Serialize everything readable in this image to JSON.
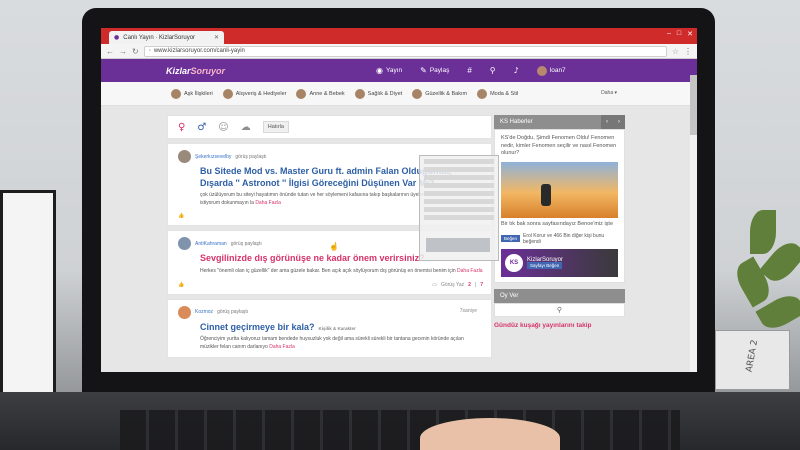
{
  "browser": {
    "tab_title": "Canlı Yayın · KizlarSoruyor",
    "url": "www.kizlarsoruyor.com/canli-yayin"
  },
  "site": {
    "logo_prefix": "Kizlar",
    "logo_suffix": "Soruyor",
    "nav": {
      "live": "Yayın",
      "share": "Paylaş",
      "hash": "#",
      "user": "loan7"
    }
  },
  "categories": [
    {
      "label": "Aşk İlişkileri"
    },
    {
      "label": "Alışveriş & Hediyeler"
    },
    {
      "label": "Anne & Bebek"
    },
    {
      "label": "Sağlık & Diyet"
    },
    {
      "label": "Güzellik & Bakım"
    },
    {
      "label": "Moda & Stil"
    }
  ],
  "categories_more": "Daha",
  "filter": {
    "chip": "Hatırla"
  },
  "posts": [
    {
      "author": "Şekerkızsevelby",
      "action": "görüş paylaştı",
      "title": "Bu Sitede Mod vs. Master Guru ft. admin Falan Olduğunda, Dışarda '' Astronot '' İlgisi Göreceğini Düşünen Var Mı?",
      "body": "çok üzülüyorum bu siteyi hayatımın önünde tutan ve her söylemeni kafasına takıp başkalarının üyelere lütfen örneklemek istiyorum dokunmayın la",
      "more": "Daha Fazla"
    },
    {
      "author": "AntiKahraman",
      "action": "görüş paylaştı",
      "title": "Sevgilinizde dış görünüşe ne kadar önem verirsiniz?",
      "body": "Herkes \"önemli olan iç güzellik\" der ama güzele bakar. Ben açık açık söylüyorum dış görünüş en önemisi benim için",
      "more": "Daha Fazla",
      "footer_label": "Görüş Yaz",
      "footer_a": "2",
      "footer_b": "7"
    },
    {
      "author": "Kozmoz",
      "action": "görüş paylaştı",
      "time": "7saniye",
      "title": "Cinnet geçirmeye bir kala?",
      "tag": "Kişilik & Karakter",
      "body": "Öğrenciyim yurtta kalıyoruz tamam bendede huysuzluk yok değil ama sürekli sürekli bir tantana gecenin köründe açılan müzikler felan canım darlanıyo",
      "more": "Daha Fazla"
    }
  ],
  "sidebar": {
    "news_title": "KS Haberler",
    "news_text": "KS'de Doğdu, Şimdi Fenomen Oldu! Fenomen nedir, kimler Fenomen seçilir ve nasıl Fenomen olunur?",
    "news_more": "Bir tık bak sonra sayfasındayız Benoe'miz işte",
    "fb_like": "Beğen",
    "fb_text": "Erol Korur ve 466 Bin diğer kişi bunu beğendi",
    "kz_title": "KizlarSoruyor",
    "kz_like": "Sayfayı Beğen",
    "poll_title": "Oy Ver",
    "promo": "Gündüz kuşağı yayınlarını takip"
  },
  "colors": {
    "brand_purple": "#6b2f98",
    "accent_pink": "#d6336c",
    "link_blue": "#2d5fa5",
    "chrome_red": "#cf2b2b"
  }
}
